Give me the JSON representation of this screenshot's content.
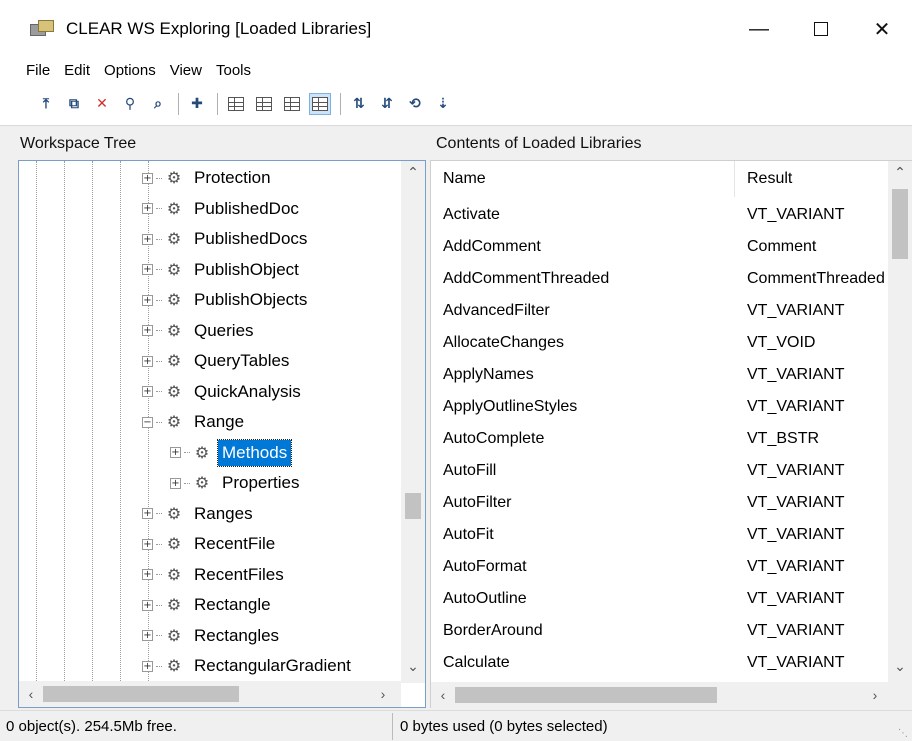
{
  "window": {
    "title": "CLEAR WS Exploring [Loaded Libraries]"
  },
  "menu": [
    "File",
    "Edit",
    "Options",
    "View",
    "Tools"
  ],
  "toolbar": {
    "buttons": [
      {
        "icon": "up-folder-icon"
      },
      {
        "icon": "copy-icon"
      },
      {
        "icon": "delete-x-icon",
        "glyph": "✕",
        "color": "#d03030"
      },
      {
        "icon": "search-icon",
        "glyph": "⚲"
      },
      {
        "icon": "find-icon"
      },
      {
        "icon": "new-folder-icon"
      },
      {
        "icon": "large-icons-view-icon"
      },
      {
        "icon": "small-icons-view-icon"
      },
      {
        "icon": "list-view-icon"
      },
      {
        "icon": "details-view-icon",
        "active": true
      },
      {
        "icon": "sort-name-icon"
      },
      {
        "icon": "sort-type-icon"
      },
      {
        "icon": "sort-date-icon"
      },
      {
        "icon": "sort-size-icon"
      }
    ]
  },
  "left_pane": {
    "header": "Workspace Tree",
    "tree_items": [
      {
        "label": "Protection",
        "level": 0,
        "expander": "+"
      },
      {
        "label": "PublishedDoc",
        "level": 0,
        "expander": "+"
      },
      {
        "label": "PublishedDocs",
        "level": 0,
        "expander": "+"
      },
      {
        "label": "PublishObject",
        "level": 0,
        "expander": "+"
      },
      {
        "label": "PublishObjects",
        "level": 0,
        "expander": "+"
      },
      {
        "label": "Queries",
        "level": 0,
        "expander": "+"
      },
      {
        "label": "QueryTables",
        "level": 0,
        "expander": "+"
      },
      {
        "label": "QuickAnalysis",
        "level": 0,
        "expander": "+"
      },
      {
        "label": "Range",
        "level": 0,
        "expander": "−"
      },
      {
        "label": "Methods",
        "level": 1,
        "expander": "+",
        "selected": true
      },
      {
        "label": "Properties",
        "level": 1,
        "expander": "+"
      },
      {
        "label": "Ranges",
        "level": 0,
        "expander": "+"
      },
      {
        "label": "RecentFile",
        "level": 0,
        "expander": "+"
      },
      {
        "label": "RecentFiles",
        "level": 0,
        "expander": "+"
      },
      {
        "label": "Rectangle",
        "level": 0,
        "expander": "+"
      },
      {
        "label": "Rectangles",
        "level": 0,
        "expander": "+"
      },
      {
        "label": "RectangularGradient",
        "level": 0,
        "expander": "+"
      }
    ]
  },
  "right_pane": {
    "header": "Contents of Loaded Libraries",
    "columns": [
      "Name",
      "Result"
    ],
    "rows": [
      [
        "Activate",
        "VT_VARIANT"
      ],
      [
        "AddComment",
        "Comment"
      ],
      [
        "AddCommentThreaded",
        "CommentThreaded"
      ],
      [
        "AdvancedFilter",
        "VT_VARIANT"
      ],
      [
        "AllocateChanges",
        "VT_VOID"
      ],
      [
        "ApplyNames",
        "VT_VARIANT"
      ],
      [
        "ApplyOutlineStyles",
        "VT_VARIANT"
      ],
      [
        "AutoComplete",
        "VT_BSTR"
      ],
      [
        "AutoFill",
        "VT_VARIANT"
      ],
      [
        "AutoFilter",
        "VT_VARIANT"
      ],
      [
        "AutoFit",
        "VT_VARIANT"
      ],
      [
        "AutoFormat",
        "VT_VARIANT"
      ],
      [
        "AutoOutline",
        "VT_VARIANT"
      ],
      [
        "BorderAround",
        "VT_VARIANT"
      ],
      [
        "Calculate",
        "VT_VARIANT"
      ]
    ]
  },
  "status": {
    "left": "0 object(s). 254.5Mb free.",
    "right": "0 bytes used (0 bytes selected)"
  },
  "colors": {
    "selection": "#0078d7",
    "focus_border": "#7a9ec8"
  }
}
